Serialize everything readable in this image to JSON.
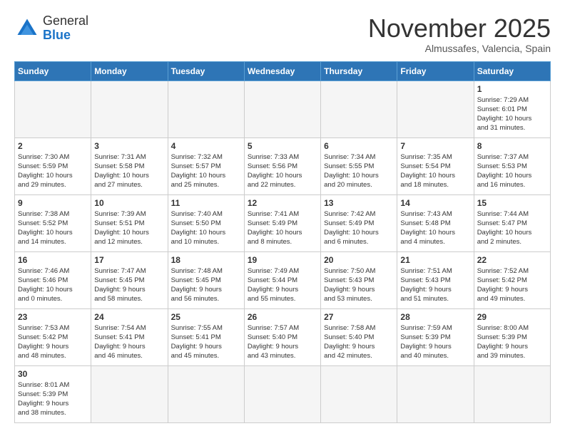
{
  "logo": {
    "general": "General",
    "blue": "Blue"
  },
  "title": "November 2025",
  "subtitle": "Almussafes, Valencia, Spain",
  "weekdays": [
    "Sunday",
    "Monday",
    "Tuesday",
    "Wednesday",
    "Thursday",
    "Friday",
    "Saturday"
  ],
  "weeks": [
    [
      {
        "day": "",
        "info": "",
        "empty": true
      },
      {
        "day": "",
        "info": "",
        "empty": true
      },
      {
        "day": "",
        "info": "",
        "empty": true
      },
      {
        "day": "",
        "info": "",
        "empty": true
      },
      {
        "day": "",
        "info": "",
        "empty": true
      },
      {
        "day": "",
        "info": "",
        "empty": true
      },
      {
        "day": "1",
        "info": "Sunrise: 7:29 AM\nSunset: 6:01 PM\nDaylight: 10 hours\nand 31 minutes."
      }
    ],
    [
      {
        "day": "2",
        "info": "Sunrise: 7:30 AM\nSunset: 5:59 PM\nDaylight: 10 hours\nand 29 minutes."
      },
      {
        "day": "3",
        "info": "Sunrise: 7:31 AM\nSunset: 5:58 PM\nDaylight: 10 hours\nand 27 minutes."
      },
      {
        "day": "4",
        "info": "Sunrise: 7:32 AM\nSunset: 5:57 PM\nDaylight: 10 hours\nand 25 minutes."
      },
      {
        "day": "5",
        "info": "Sunrise: 7:33 AM\nSunset: 5:56 PM\nDaylight: 10 hours\nand 22 minutes."
      },
      {
        "day": "6",
        "info": "Sunrise: 7:34 AM\nSunset: 5:55 PM\nDaylight: 10 hours\nand 20 minutes."
      },
      {
        "day": "7",
        "info": "Sunrise: 7:35 AM\nSunset: 5:54 PM\nDaylight: 10 hours\nand 18 minutes."
      },
      {
        "day": "8",
        "info": "Sunrise: 7:37 AM\nSunset: 5:53 PM\nDaylight: 10 hours\nand 16 minutes."
      }
    ],
    [
      {
        "day": "9",
        "info": "Sunrise: 7:38 AM\nSunset: 5:52 PM\nDaylight: 10 hours\nand 14 minutes."
      },
      {
        "day": "10",
        "info": "Sunrise: 7:39 AM\nSunset: 5:51 PM\nDaylight: 10 hours\nand 12 minutes."
      },
      {
        "day": "11",
        "info": "Sunrise: 7:40 AM\nSunset: 5:50 PM\nDaylight: 10 hours\nand 10 minutes."
      },
      {
        "day": "12",
        "info": "Sunrise: 7:41 AM\nSunset: 5:49 PM\nDaylight: 10 hours\nand 8 minutes."
      },
      {
        "day": "13",
        "info": "Sunrise: 7:42 AM\nSunset: 5:49 PM\nDaylight: 10 hours\nand 6 minutes."
      },
      {
        "day": "14",
        "info": "Sunrise: 7:43 AM\nSunset: 5:48 PM\nDaylight: 10 hours\nand 4 minutes."
      },
      {
        "day": "15",
        "info": "Sunrise: 7:44 AM\nSunset: 5:47 PM\nDaylight: 10 hours\nand 2 minutes."
      }
    ],
    [
      {
        "day": "16",
        "info": "Sunrise: 7:46 AM\nSunset: 5:46 PM\nDaylight: 10 hours\nand 0 minutes."
      },
      {
        "day": "17",
        "info": "Sunrise: 7:47 AM\nSunset: 5:45 PM\nDaylight: 9 hours\nand 58 minutes."
      },
      {
        "day": "18",
        "info": "Sunrise: 7:48 AM\nSunset: 5:45 PM\nDaylight: 9 hours\nand 56 minutes."
      },
      {
        "day": "19",
        "info": "Sunrise: 7:49 AM\nSunset: 5:44 PM\nDaylight: 9 hours\nand 55 minutes."
      },
      {
        "day": "20",
        "info": "Sunrise: 7:50 AM\nSunset: 5:43 PM\nDaylight: 9 hours\nand 53 minutes."
      },
      {
        "day": "21",
        "info": "Sunrise: 7:51 AM\nSunset: 5:43 PM\nDaylight: 9 hours\nand 51 minutes."
      },
      {
        "day": "22",
        "info": "Sunrise: 7:52 AM\nSunset: 5:42 PM\nDaylight: 9 hours\nand 49 minutes."
      }
    ],
    [
      {
        "day": "23",
        "info": "Sunrise: 7:53 AM\nSunset: 5:42 PM\nDaylight: 9 hours\nand 48 minutes."
      },
      {
        "day": "24",
        "info": "Sunrise: 7:54 AM\nSunset: 5:41 PM\nDaylight: 9 hours\nand 46 minutes."
      },
      {
        "day": "25",
        "info": "Sunrise: 7:55 AM\nSunset: 5:41 PM\nDaylight: 9 hours\nand 45 minutes."
      },
      {
        "day": "26",
        "info": "Sunrise: 7:57 AM\nSunset: 5:40 PM\nDaylight: 9 hours\nand 43 minutes."
      },
      {
        "day": "27",
        "info": "Sunrise: 7:58 AM\nSunset: 5:40 PM\nDaylight: 9 hours\nand 42 minutes."
      },
      {
        "day": "28",
        "info": "Sunrise: 7:59 AM\nSunset: 5:39 PM\nDaylight: 9 hours\nand 40 minutes."
      },
      {
        "day": "29",
        "info": "Sunrise: 8:00 AM\nSunset: 5:39 PM\nDaylight: 9 hours\nand 39 minutes."
      }
    ],
    [
      {
        "day": "30",
        "info": "Sunrise: 8:01 AM\nSunset: 5:39 PM\nDaylight: 9 hours\nand 38 minutes."
      },
      {
        "day": "",
        "info": "",
        "empty": true
      },
      {
        "day": "",
        "info": "",
        "empty": true
      },
      {
        "day": "",
        "info": "",
        "empty": true
      },
      {
        "day": "",
        "info": "",
        "empty": true
      },
      {
        "day": "",
        "info": "",
        "empty": true
      },
      {
        "day": "",
        "info": "",
        "empty": true
      }
    ]
  ]
}
